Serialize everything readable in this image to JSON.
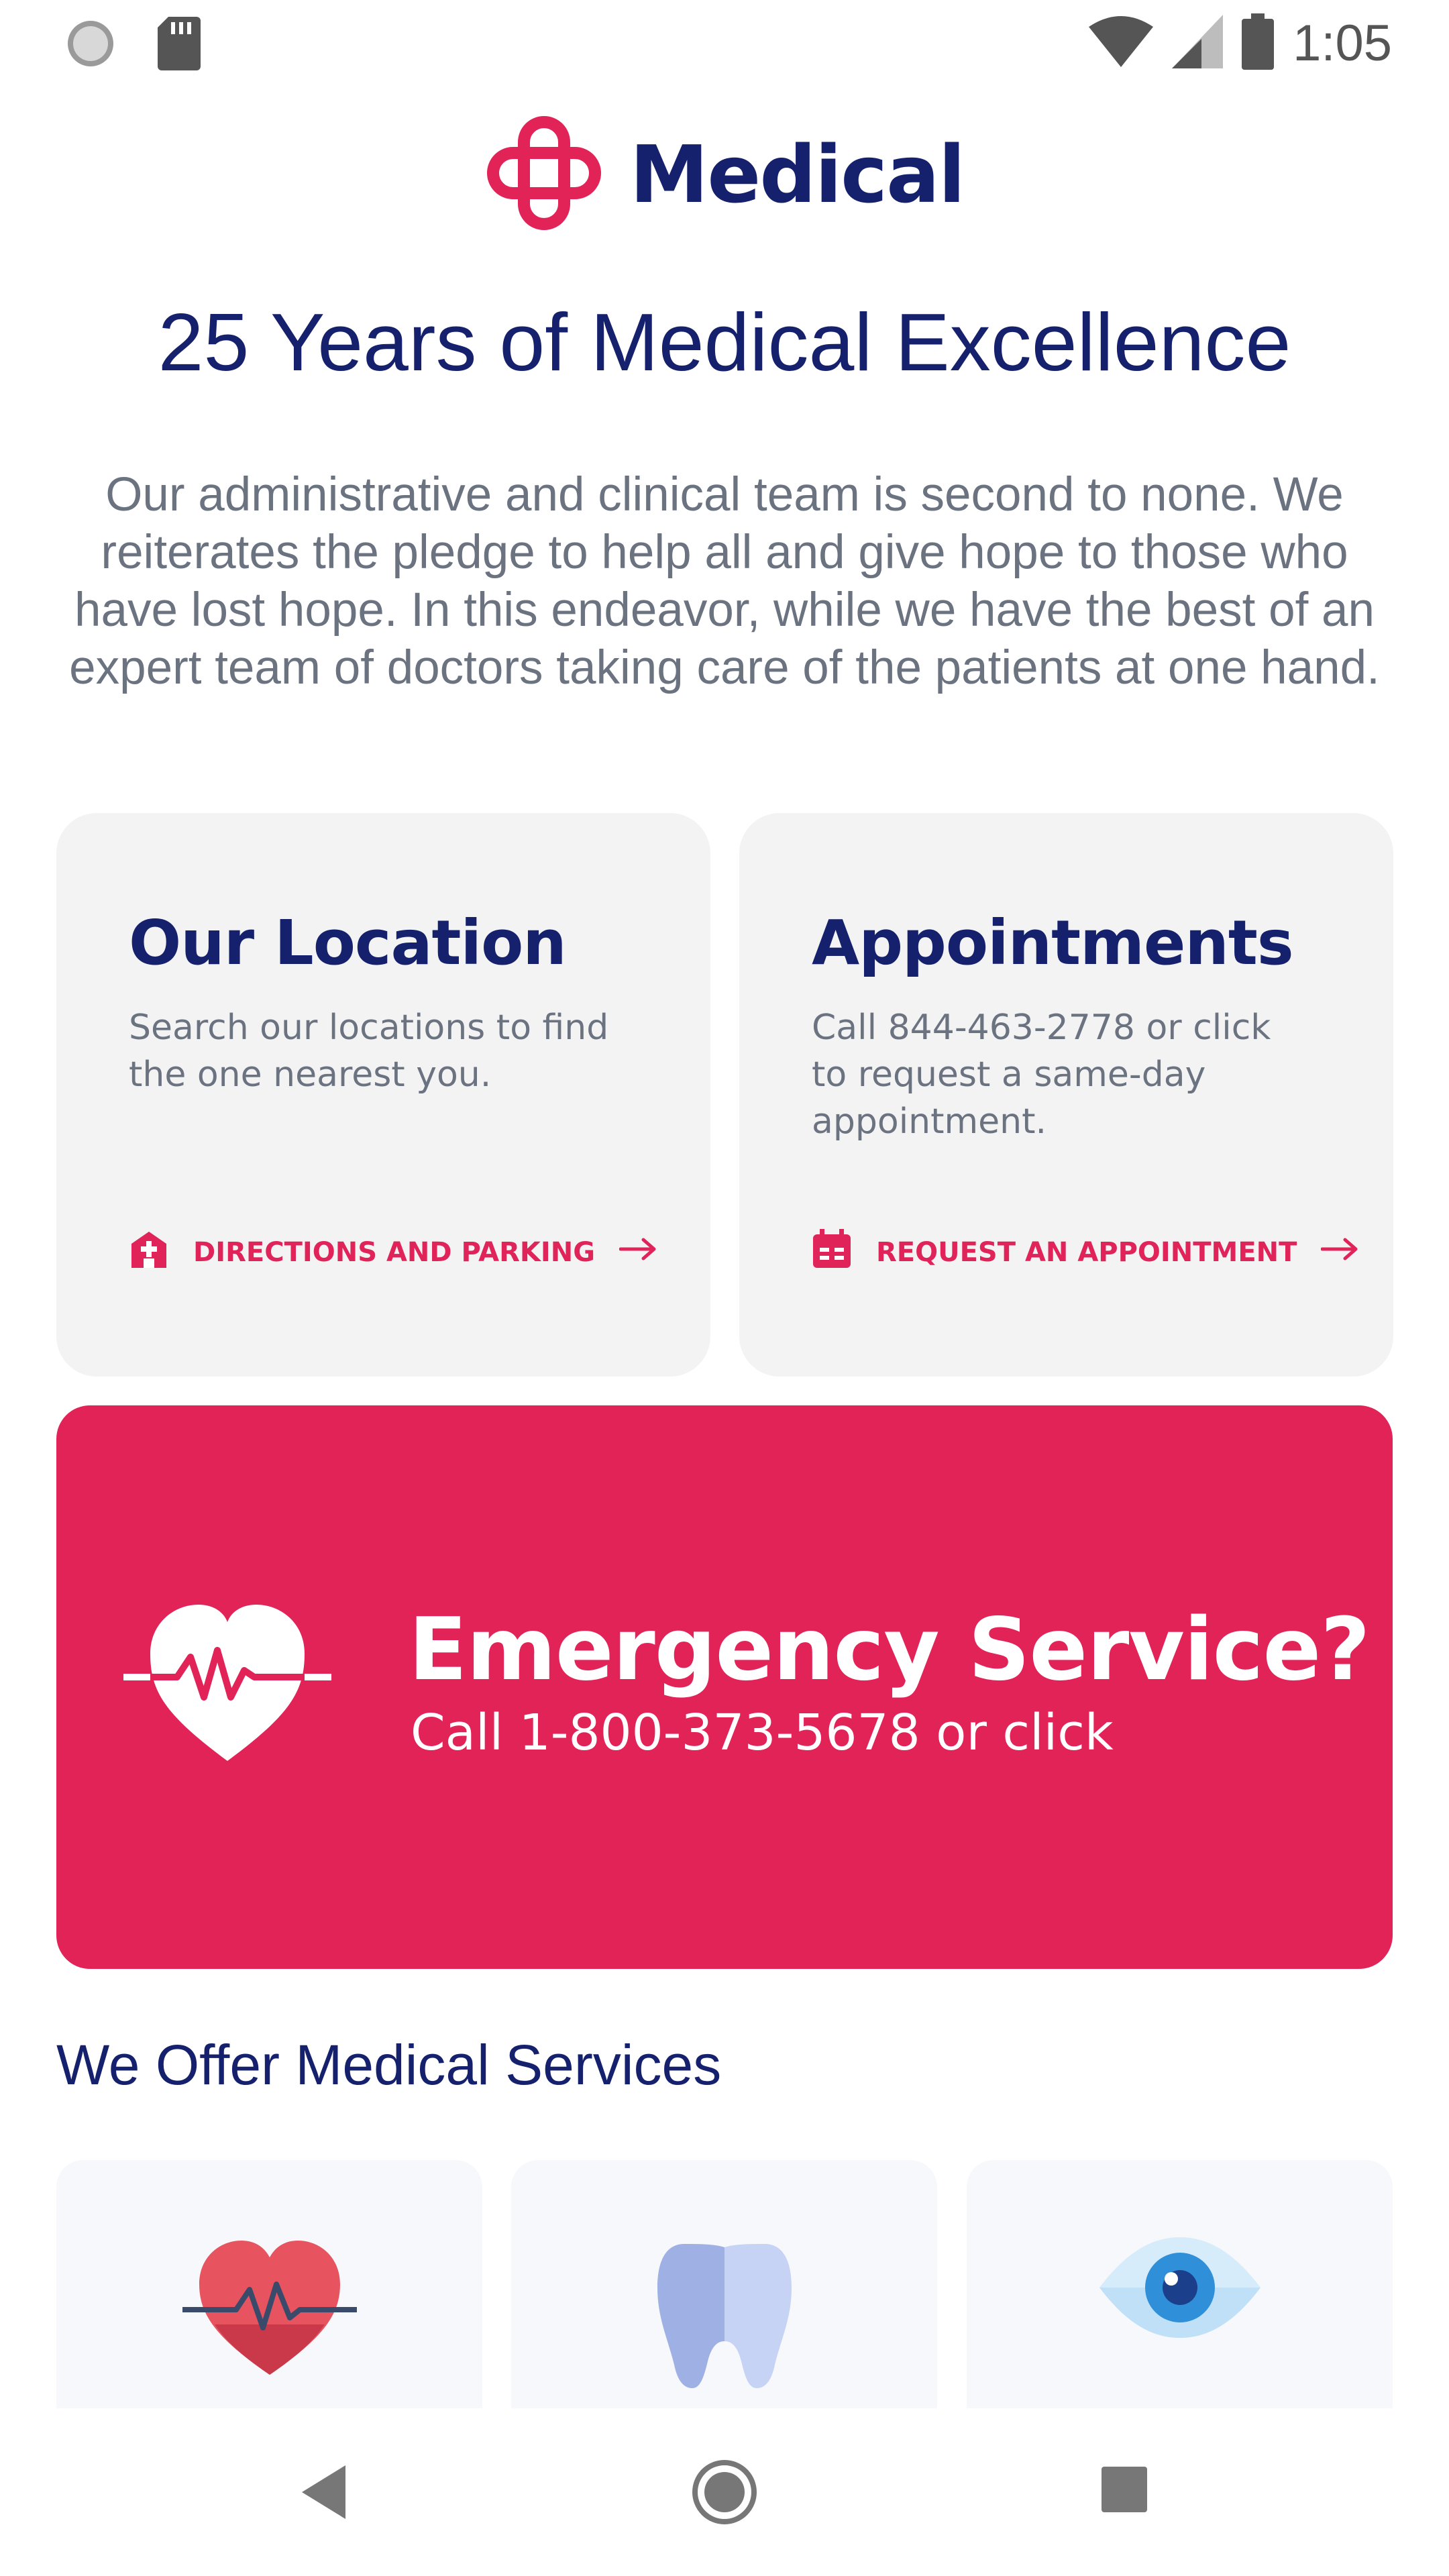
{
  "status_bar": {
    "time": "1:05",
    "icons": [
      "circle-icon",
      "sd-card-icon",
      "wifi-icon",
      "signal-icon",
      "battery-icon"
    ]
  },
  "header": {
    "logo_text": "Medical"
  },
  "hero": {
    "headline": "25 Years of Medical Excellence",
    "intro": "Our administrative and clinical team is second to none. We reiterates the pledge to help all and give hope to those who have lost hope. In this endeavor, while we have the best of an expert team of doctors taking care of the patients at one hand."
  },
  "cards": {
    "location": {
      "title": "Our Location",
      "description": "Search our locations to find the one nearest you.",
      "link_label": "DIRECTIONS AND PARKING",
      "icon": "hospital-icon"
    },
    "appointments": {
      "title": "Appointments",
      "description": "Call 844-463-2778 or click to request a same-day appointment.",
      "link_label": "REQUEST AN APPOINTMENT",
      "icon": "calendar-icon"
    }
  },
  "emergency": {
    "title": "Emergency Service?",
    "subtitle": "Call 1-800-373-5678 or click",
    "icon": "heartbeat-icon"
  },
  "services": {
    "heading": "We Offer Medical Services",
    "items": [
      {
        "icon": "heart-icon"
      },
      {
        "icon": "tooth-icon"
      },
      {
        "icon": "eye-icon"
      }
    ]
  },
  "nav_bar": {
    "buttons": [
      "back-icon",
      "home-icon",
      "recents-icon"
    ]
  },
  "colors": {
    "brand_navy": "#16216e",
    "brand_red": "#e22357",
    "card_bg": "#f3f3f4",
    "muted_text": "#6b7280"
  }
}
